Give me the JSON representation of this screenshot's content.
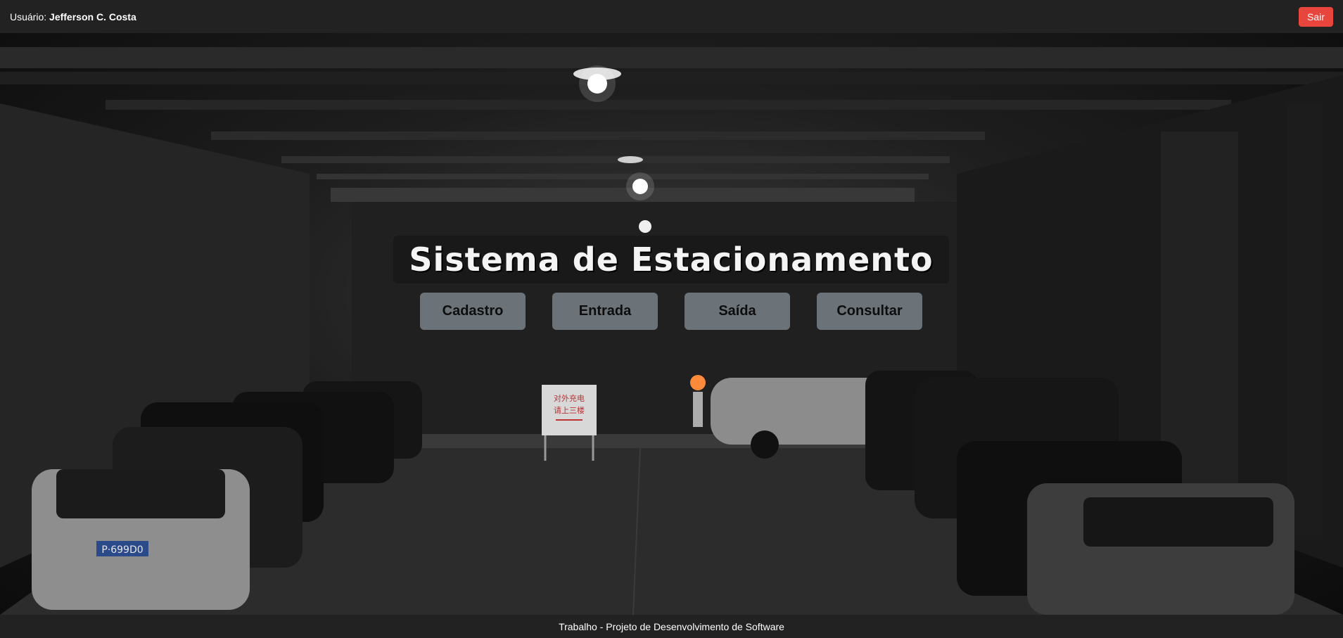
{
  "header": {
    "user_label": "Usuário:",
    "user_name": "Jefferson C. Costa",
    "logout_label": "Sair"
  },
  "hero": {
    "title": "Sistema de Estacionamento",
    "sign_text_line1": "对外充电",
    "sign_text_line2": "请上三楼",
    "plate_text": "P·699D0"
  },
  "menu": {
    "items": [
      {
        "label": "Cadastro"
      },
      {
        "label": "Entrada"
      },
      {
        "label": "Saída"
      },
      {
        "label": "Consultar"
      }
    ]
  },
  "footer": {
    "text": "Trabalho - Projeto de Desenvolvimento de Software"
  },
  "colors": {
    "topbar": "#222222",
    "logout": "#e8453c",
    "menu_button": "#6b7278"
  }
}
